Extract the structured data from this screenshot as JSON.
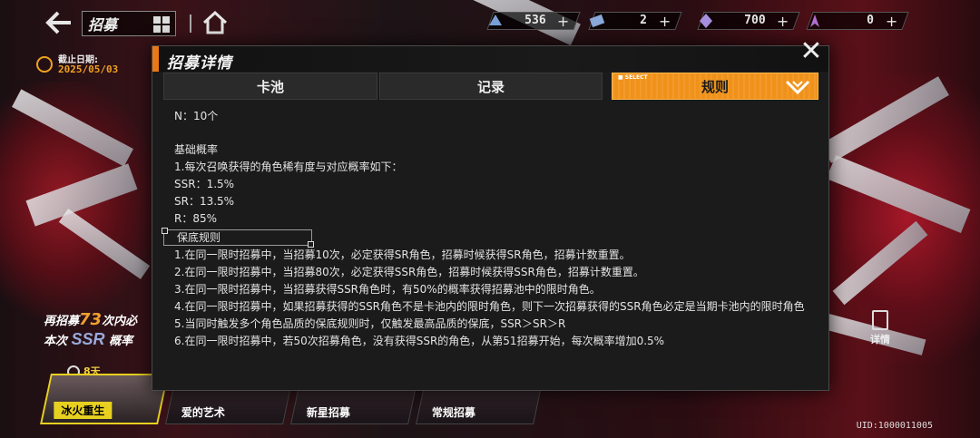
{
  "header": {
    "title": "招募",
    "resources": [
      {
        "icon": "crystal-icon",
        "value": "536"
      },
      {
        "icon": "ticket-icon",
        "value": "2"
      },
      {
        "icon": "gem-icon",
        "value": "700"
      },
      {
        "icon": "shard-icon",
        "value": "0"
      }
    ],
    "plus": "+"
  },
  "deadline": {
    "label": "截止日期:",
    "date": "2025/05/03"
  },
  "left_info": {
    "line1_prefix": "再招募",
    "line1_num": "73",
    "line1_suffix": "次内必",
    "line2_prefix": "本次",
    "line2_ssr": "SSR",
    "line2_suffix": "概率"
  },
  "badge_days": "8天",
  "banners": [
    {
      "label": "冰火重生"
    },
    {
      "label": "爱的艺术"
    },
    {
      "label": "新星招募"
    },
    {
      "label": "常规招募"
    }
  ],
  "uid": "UID:1000011005",
  "detail_button": "详情",
  "modal": {
    "title": "招募详情",
    "close": "✕",
    "tabs": [
      {
        "label": "卡池"
      },
      {
        "label": "记录"
      },
      {
        "label": "规则",
        "select_tag": "■ SELECT"
      }
    ],
    "content": {
      "n_line": "N：10个",
      "base_title": "基础概率",
      "base_intro": "1.每次召唤获得的角色稀有度与对应概率如下：",
      "ssr": "SSR：1.5%",
      "sr": "SR：13.5%",
      "r": "R：85%",
      "guarantee_title": "保底规则",
      "rules": [
        "1.在同一限时招募中，当招募10次，必定获得SR角色，招募时候获得SR角色，招募计数重置。",
        "2.在同一限时招募中，当招募80次，必定获得SSR角色，招募时候获得SSR角色，招募计数重置。",
        "3.在同一限时招募中，当招募获得SSR角色时，有50%的概率获得招募池中的限时角色。",
        "4.在同一限时招募中，如果招募获得的SSR角色不是卡池内的限时角色，则下一次招募获得的SSR角色必定是当期卡池内的限时角色",
        "5.当同时触发多个角色品质的保底规则时，仅触发最高品质的保底，SSR＞SR＞R",
        "6.在同一限时招募中，若50次招募角色，没有获得SSR的角色，从第51招募开始，每次概率增加0.5%"
      ]
    }
  },
  "colors": {
    "accent": "#f0921a",
    "modal_bg": "#1b1b1c",
    "highlight": "#e8d020"
  }
}
